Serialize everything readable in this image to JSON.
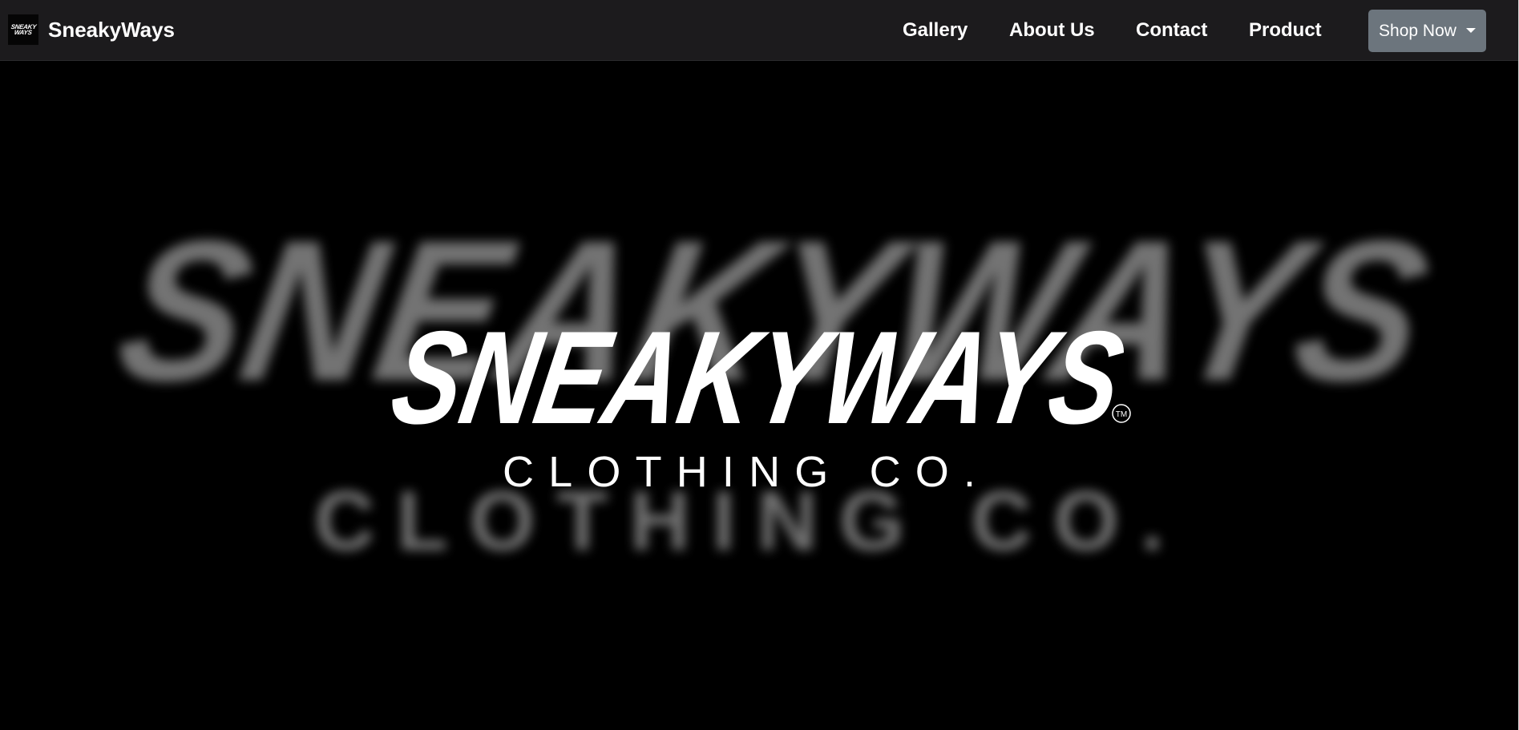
{
  "brand": {
    "logo_text": "SNEAKY\nWAYS",
    "name": "SneakyWays"
  },
  "nav": {
    "links": [
      {
        "label": "Gallery"
      },
      {
        "label": "About Us"
      },
      {
        "label": "Contact"
      },
      {
        "label": "Product"
      }
    ],
    "shop_button": "Shop Now"
  },
  "hero": {
    "logo_main": "SNEAKYWAYS",
    "logo_tm": "TM",
    "logo_sub": "CLOTHING CO."
  },
  "colors": {
    "navbar_bg": "#1c1b1d",
    "hero_bg": "#000000",
    "button_bg": "#6c757d",
    "logo_text": "#ffffff",
    "blur_logo": "#ffffff"
  }
}
